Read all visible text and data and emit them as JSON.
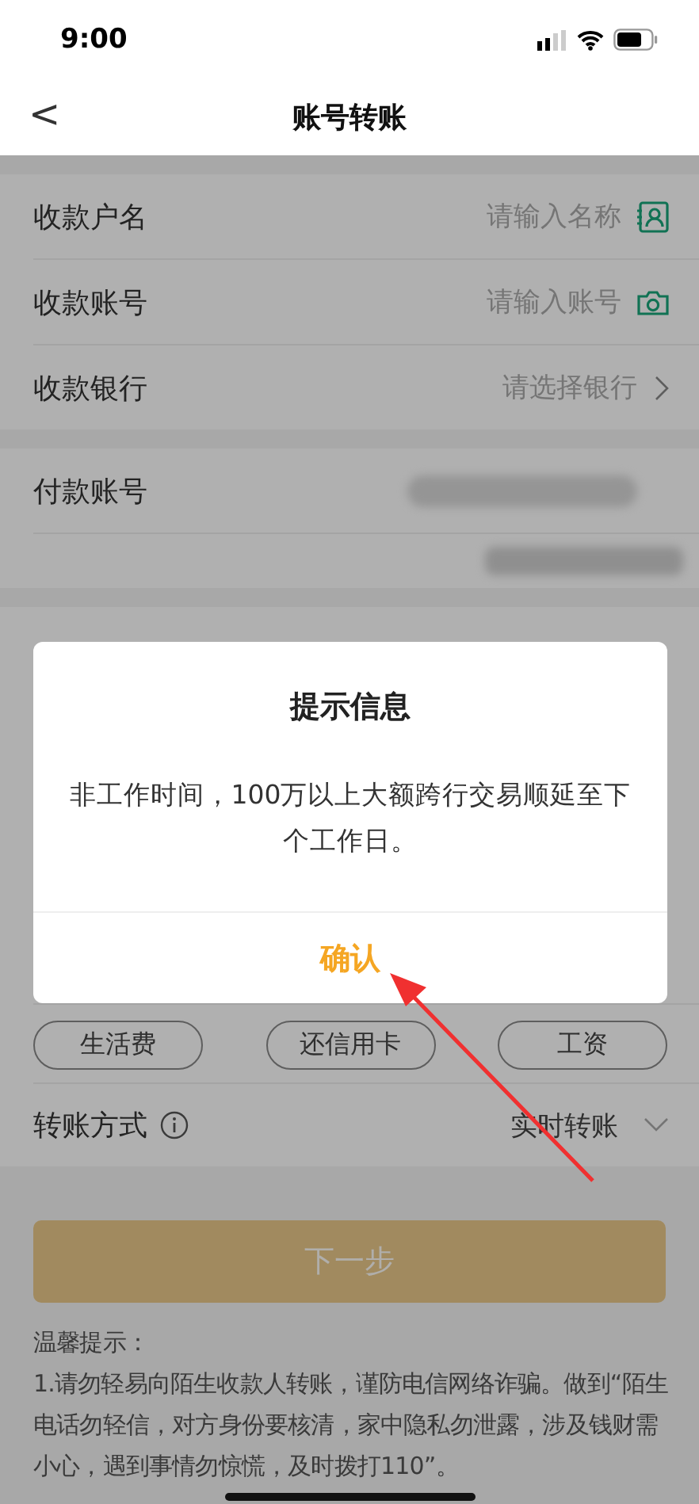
{
  "status_bar": {
    "time": "9:00"
  },
  "nav": {
    "title": "账号转账",
    "back": "<"
  },
  "payee_rows": [
    {
      "label": "收款户名",
      "placeholder": "请输入名称",
      "kind": "contact"
    },
    {
      "label": "收款账号",
      "placeholder": "请输入账号",
      "kind": "camera"
    },
    {
      "label": "收款银行",
      "placeholder": "请选择银行",
      "kind": "select"
    }
  ],
  "payer": {
    "label": "付款账号"
  },
  "purpose_tags": [
    {
      "label": "生活费"
    },
    {
      "label": "还信用卡"
    },
    {
      "label": "工资"
    }
  ],
  "transfer_method": {
    "label": "转账方式",
    "value": "实时转账"
  },
  "next_button": {
    "label": "下一步",
    "disabled": true
  },
  "tips": {
    "heading": "温馨提示：",
    "text": "1.请勿轻易向陌生收款人转账，谨防电信网络诈骗。做到“陌生电话勿轻信，对方身份要核清，家中隐私勿泄露，涉及钱财需小心，遇到事情勿惊慌，及时拨打110”。"
  },
  "dialog": {
    "title": "提示信息",
    "message": "非工作时间，100万以上大额跨行交易顺延至下个工作日。",
    "confirm": "确认"
  }
}
